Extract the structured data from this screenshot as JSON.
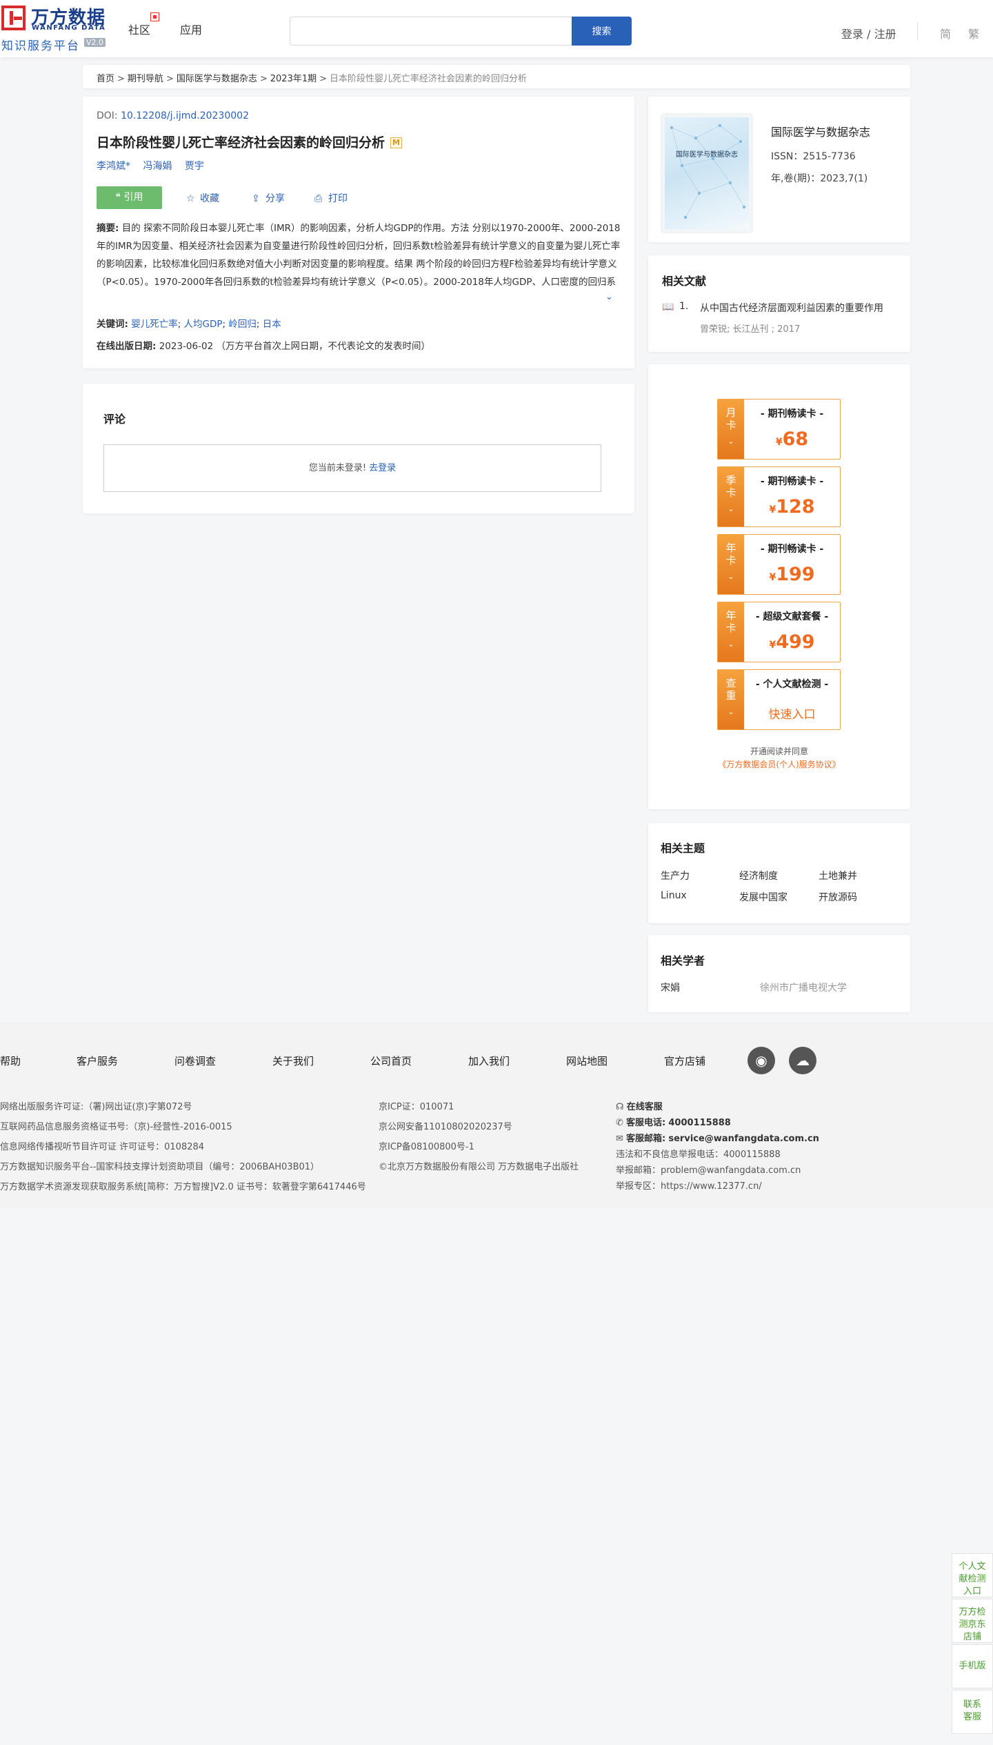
{
  "header": {
    "logo_cn": "万方数据",
    "logo_en": "WANFANG DATA",
    "logo_sub": "知识服务平台",
    "logo_version": "V2.0",
    "nav": [
      "社区",
      "应用"
    ],
    "search_placeholder": "",
    "search_button": "搜索",
    "login": "登录 / 注册",
    "lang_simplified": "简",
    "lang_traditional": "繁"
  },
  "breadcrumb": {
    "items": [
      "首页",
      "期刊导航",
      "国际医学与数据杂志",
      "2023年1期"
    ],
    "separator": ">",
    "current": "日本阶段性婴儿死亡率经济社会因素的岭回归分析"
  },
  "article": {
    "doi_label": "DOI:",
    "doi": "10.12208/j.ijmd.20230002",
    "title": "日本阶段性婴儿死亡率经济社会因素的岭回归分析",
    "badge": "M",
    "authors": [
      "李鸿斌*",
      "冯海娟",
      "贾宇"
    ],
    "actions": {
      "cite": "引用",
      "favorite": "收藏",
      "share": "分享",
      "print": "打印"
    },
    "abstract_label": "摘要:",
    "abstract": "目的 探索不同阶段日本婴儿死亡率（IMR）的影响因素，分析人均GDP的作用。方法 分别以1970-2000年、2000-2018年的IMR为因变量、相关经济社会因素为自变量进行阶段性岭回归分析，回归系数t检验差异有统计学意义的自变量为婴儿死亡率的影响因素，比较标准化回归系数绝对值大小判断对因变量的影响程度。结果 两个阶段的岭回归方程F检验差异均有统计学意义（P<0.05）。1970-2000年各回归系数的t检验差异均有统计学意义（P<0.05）。2000-2018年人均GDP、人口密度的回归系数t检验差异均无统计学意义（P>0.05），其他的均有统计学意义（P<0.05）。按标准化回归...",
    "keywords_label": "关键词:",
    "keywords": [
      "婴儿死亡率",
      "人均GDP",
      "岭回归",
      "日本"
    ],
    "pubdate_label": "在线出版日期:",
    "pubdate": "2023-06-02",
    "pubdate_note": "（万方平台首次上网日期，不代表论文的发表时间）"
  },
  "comment": {
    "title": "评论",
    "not_logged_in": "您当前未登录!",
    "login_link": "去登录"
  },
  "journal": {
    "cover_title": "国际医学与数据杂志",
    "name": "国际医学与数据杂志",
    "issn": "ISSN：2515-7736",
    "year_issue": "年,卷(期)：2023,7(1)"
  },
  "related": {
    "title": "相关文献",
    "items": [
      {
        "num": "1.",
        "title": "从中国古代经济层面观利益因素的重要作用",
        "meta": "曾荣锐; 长江丛刊 ; 2017"
      }
    ]
  },
  "promo": {
    "cards": [
      {
        "tab": "月卡",
        "head": "- 期刊畅读卡 -",
        "currency": "¥",
        "price": "68"
      },
      {
        "tab": "季卡",
        "head": "- 期刊畅读卡 -",
        "currency": "¥",
        "price": "128"
      },
      {
        "tab": "年卡",
        "head": "- 期刊畅读卡 -",
        "currency": "¥",
        "price": "199"
      },
      {
        "tab": "年卡",
        "head": "- 超级文献套餐 -",
        "currency": "¥",
        "price": "499"
      },
      {
        "tab": "查重",
        "head": "- 个人文献检测 -",
        "entry": "快速入口"
      }
    ],
    "note1": "开通阅读并同意",
    "note2": "《万方数据会员(个人)服务协议》"
  },
  "topics": {
    "title": "相关主题",
    "items": [
      "生产力",
      "经济制度",
      "土地兼并",
      "Linux",
      "发展中国家",
      "开放源码"
    ]
  },
  "scholars": {
    "title": "相关学者",
    "items": [
      {
        "name": "宋娟",
        "org": "徐州市广播电视大学"
      }
    ]
  },
  "footer": {
    "links": [
      "帮助",
      "客户服务",
      "问卷调查",
      "关于我们",
      "公司首页",
      "加入我们",
      "网站地图",
      "官方店铺"
    ],
    "col1": [
      "网络出版服务许可证:（署)网出证(京)字第072号",
      "互联网药品信息服务资格证书号:（京)-经营性-2016-0015",
      "信息网络传播视听节目许可证 许可证号：0108284",
      "万方数据知识服务平台--国家科技支撑计划资助项目（编号：2006BAH03B01）",
      "万方数据学术资源发现获取服务系统[简称：万方智搜]V2.0 证书号：软著登字第6417446号"
    ],
    "col2": [
      "京ICP证：010071",
      "京公网安备11010802020237号",
      "京ICP备08100800号-1",
      "©北京万方数据股份有限公司 万方数据电子出版社"
    ],
    "online_service": "在线客服",
    "phone_label": "客服电话:",
    "phone": "4000115888",
    "email_label": "客服邮箱:",
    "email": "service@wanfangdata.com.cn",
    "report_phone": "违法和不良信息举报电话：4000115888",
    "report_email": "举报邮箱：problem@wanfangdata.com.cn",
    "report_site": "举报专区：https://www.12377.cn/"
  },
  "float_bar": [
    "个人文献检测入口",
    "万方检测京东店铺",
    "手机版",
    "联系客服"
  ],
  "colors": {
    "brand_blue": "#2a61b8",
    "cite_green": "#6dbb6d",
    "promo_orange": "#f06b1f",
    "logo_red": "#d82b2b"
  }
}
